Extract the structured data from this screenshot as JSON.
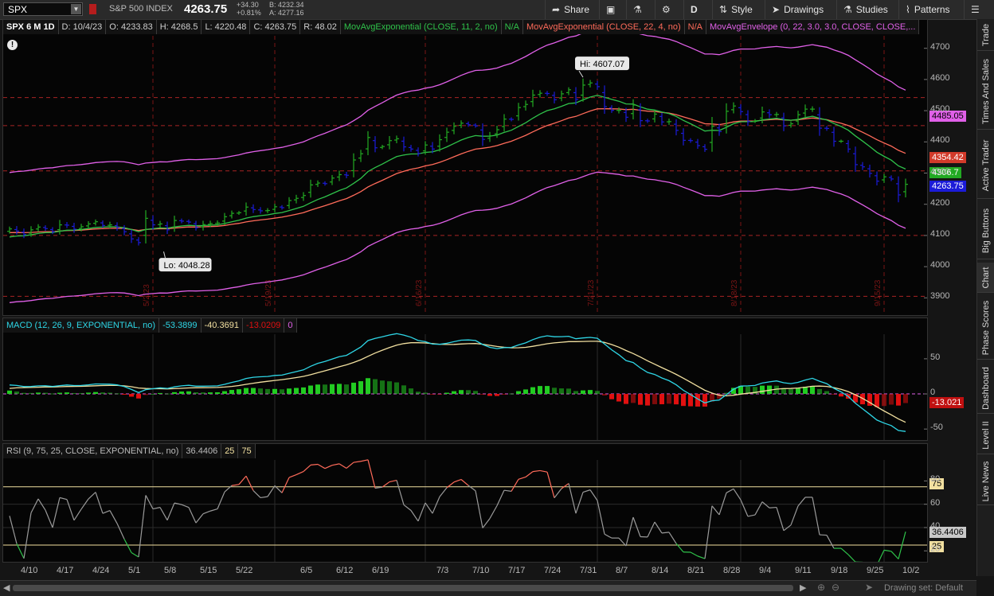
{
  "toolbar": {
    "symbol": "SPX",
    "symbol_name": "S&P 500 INDEX",
    "last": "4263.75",
    "net_change": "+34.30",
    "pct_change": "+0.81%",
    "bid": "B: 4232.34",
    "ask": "A: 4277.16",
    "buttons": {
      "share": "Share",
      "interval": "D",
      "style": "Style",
      "drawings": "Drawings",
      "studies": "Studies",
      "patterns": "Patterns"
    }
  },
  "price_header": {
    "title": "SPX 6 M 1D",
    "date": "D: 10/4/23",
    "open": "O: 4233.83",
    "high": "H: 4268.5",
    "low": "L: 4220.48",
    "close": "C: 4263.75",
    "range": "R: 48.02",
    "ema_fast": "MovAvgExponential (CLOSE, 11, 2, no)",
    "ema_fast_val": "N/A",
    "ema_slow": "MovAvgExponential (CLOSE, 22, 4, no)",
    "ema_slow_val": "N/A",
    "envelope": "MovAvgEnvelope (0, 22, 3.0, 3.0, CLOSE, CLOSE,..."
  },
  "macd_header": {
    "title": "MACD (12, 26, 9, EXPONENTIAL, no)",
    "value": "-53.3899",
    "avg": "-40.3691",
    "diff": "-13.0209",
    "zero": "0"
  },
  "rsi_header": {
    "title": "RSI (9, 75, 25, CLOSE, EXPONENTIAL, no)",
    "value": "36.4406",
    "over_bought": "25",
    "over_sold": "75"
  },
  "axis_flags": {
    "upper_env": "4485.05",
    "ema_slow": "4354.42",
    "ema_fast": "4306.7",
    "last": "4263.75",
    "macd_diff": "-13.021",
    "rsi_ob": "75",
    "rsi_os": "25",
    "rsi_val": "36.4406"
  },
  "annotations": {
    "hi": "Hi: 4607.07",
    "lo": "Lo: 4048.28"
  },
  "bottom_bar": {
    "drawing_set": "Drawing set: Default"
  },
  "sidebar_tabs": [
    "Trade",
    "Times And Sales",
    "Active Trader",
    "Big Buttons",
    "Chart",
    "Phase Scores",
    "Dashboard",
    "Level II",
    "Live News"
  ],
  "colors": {
    "ema_fast": "#2fc24a",
    "ema_slow": "#ff6b5a",
    "envelope": "#e060e8",
    "up_bar": "#22aa22",
    "down_bar": "#1b1bd8",
    "macd_value": "#2ed6e6",
    "macd_avg": "#f2e0a0",
    "hist_pos": "#22cc22",
    "hist_neg": "#e01010",
    "rsi_line": "#9a9a9a",
    "bg": "#050505"
  },
  "chart_data": [
    {
      "type": "candlestick",
      "title": "SPX 6 M 1D",
      "x_tick_labels": [
        "4/10",
        "4/17",
        "4/24",
        "5/1",
        "5/8",
        "5/15",
        "5/22",
        "6/5",
        "6/12",
        "6/19",
        "7/3",
        "7/10",
        "7/17",
        "7/24",
        "7/31",
        "8/7",
        "8/14",
        "8/21",
        "8/28",
        "9/4",
        "9/11",
        "9/18",
        "9/25",
        "10/2"
      ],
      "month_markers": [
        "5/2/23",
        "5/19/23",
        "6/16/23",
        "7/21/23",
        "8/18/23",
        "9/15/23"
      ],
      "ylim": [
        3860,
        4740
      ],
      "y_ticks": [
        3900,
        4000,
        4100,
        4200,
        4300,
        4400,
        4500,
        4600,
        4700
      ],
      "hlines": [
        3905,
        4100,
        4307,
        4452,
        4542
      ],
      "close": [
        4121,
        4114,
        4103,
        4118,
        4127,
        4122,
        4112,
        4134,
        4133,
        4120,
        4128,
        4137,
        4144,
        4132,
        4134,
        4126,
        4112,
        4089,
        4077,
        4155,
        4134,
        4137,
        4118,
        4148,
        4146,
        4143,
        4125,
        4135,
        4138,
        4140,
        4160,
        4171,
        4173,
        4191,
        4183,
        4179,
        4180,
        4192,
        4189,
        4212,
        4219,
        4228,
        4262,
        4268,
        4266,
        4284,
        4295,
        4293,
        4342,
        4362,
        4414,
        4381,
        4385,
        4404,
        4410,
        4384,
        4377,
        4363,
        4390,
        4377,
        4407,
        4431,
        4450,
        4460,
        4455,
        4451,
        4408,
        4420,
        4439,
        4473,
        4472,
        4510,
        4520,
        4550,
        4556,
        4555,
        4535,
        4554,
        4567,
        4536,
        4582,
        4589,
        4577,
        4513,
        4501,
        4501,
        4479,
        4518,
        4468,
        4467,
        4489,
        4464,
        4465,
        4437,
        4405,
        4404,
        4388,
        4376,
        4450,
        4433,
        4498,
        4515,
        4497,
        4465,
        4468,
        4496,
        4487,
        4488,
        4451,
        4458,
        4487,
        4505,
        4505,
        4444,
        4443,
        4402,
        4402,
        4377,
        4327,
        4320,
        4299,
        4274,
        4288,
        4281,
        4230,
        4264
      ],
      "hi": 4607.07,
      "lo": 4048.28,
      "ema_fast": {
        "start": 4090,
        "end": 4306.7
      },
      "ema_slow": {
        "start": 4108,
        "end": 4354.42
      },
      "envelope_upper_last": 4485.05
    },
    {
      "type": "histogram+line",
      "title": "MACD (12, 26, 9, EXPONENTIAL, no)",
      "ylim": [
        -60,
        85
      ],
      "y_ticks": [
        50,
        0,
        -50
      ],
      "value": -53.3899,
      "avg": -40.3691,
      "diff": -13.0209
    },
    {
      "type": "line",
      "title": "RSI (9, 75, 25, CLOSE, EXPONENTIAL, no)",
      "ylim": [
        12,
        98
      ],
      "y_ticks": [
        20,
        40,
        60,
        80
      ],
      "levels": [
        75,
        25
      ],
      "value": 36.4406
    }
  ]
}
